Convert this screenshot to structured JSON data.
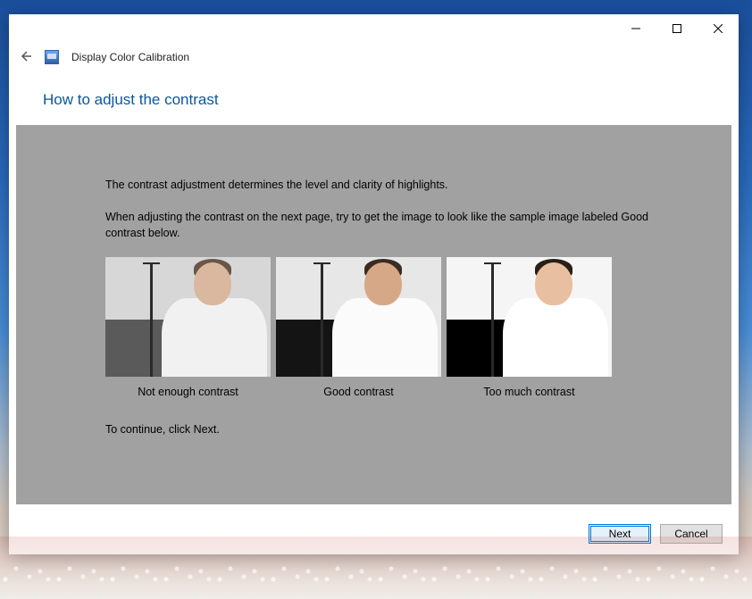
{
  "window": {
    "app_title": "Display Color Calibration",
    "heading": "How to adjust the contrast"
  },
  "body": {
    "para1": "The contrast adjustment determines the level and clarity of highlights.",
    "para2": "When adjusting the contrast on the next page, try to get the image to look like the sample image labeled Good contrast below.",
    "continue": "To continue, click Next."
  },
  "samples": {
    "low": "Not enough contrast",
    "good": "Good contrast",
    "high": "Too much contrast"
  },
  "buttons": {
    "next": "Next",
    "cancel": "Cancel"
  }
}
